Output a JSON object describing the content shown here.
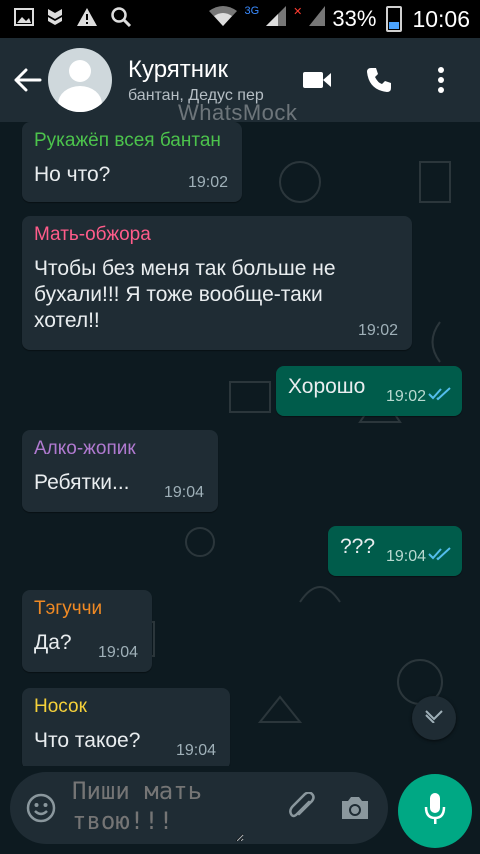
{
  "status_bar": {
    "network_label": "3G",
    "battery_percent": "33%",
    "time": "10:06",
    "icons": [
      "picture-icon",
      "shield-icon",
      "warning-icon",
      "search-icon",
      "wifi-icon",
      "signal-icon",
      "battery-icon"
    ]
  },
  "header": {
    "title": "Курятник",
    "subtitle": "бантан, Дедус пер",
    "watermark": "WhatsMock",
    "icons": [
      "back-arrow-icon",
      "avatar",
      "video-call-icon",
      "phone-icon",
      "more-vertical-icon"
    ]
  },
  "messages": [
    {
      "direction": "in",
      "sender": "Рукажёп всея бантан",
      "sender_color": "#4cc34c",
      "text": "Но что?",
      "time": "19:02"
    },
    {
      "direction": "in",
      "sender": "Мать-обжора",
      "sender_color": "#ff5c8a",
      "text": "Чтобы без меня так больше не бухали!!! Я тоже вообще-таки хотел!!",
      "time": "19:02"
    },
    {
      "direction": "out",
      "text": "Хорошо",
      "time": "19:02",
      "read": true
    },
    {
      "direction": "in",
      "sender": "Алко-жопик",
      "sender_color": "#b07ad0",
      "text": "Ребятки...",
      "time": "19:04"
    },
    {
      "direction": "out",
      "text": "???",
      "time": "19:04",
      "read": true
    },
    {
      "direction": "in",
      "sender": "Тэгуччи",
      "sender_color": "#f08a24",
      "text": "Да?",
      "time": "19:04"
    },
    {
      "direction": "in",
      "sender": "Носок",
      "sender_color": "#f5d13a",
      "text": "Что такое?",
      "time": "19:04"
    }
  ],
  "composer": {
    "placeholder": "Пиши мать твою!!!"
  },
  "colors": {
    "header_bg": "#1f2c34",
    "chat_bg": "#0d1a20",
    "incoming_bubble": "#1f2c34",
    "outgoing_bubble": "#005c4b",
    "accent": "#00a884",
    "read_ticks": "#53bdeb"
  }
}
